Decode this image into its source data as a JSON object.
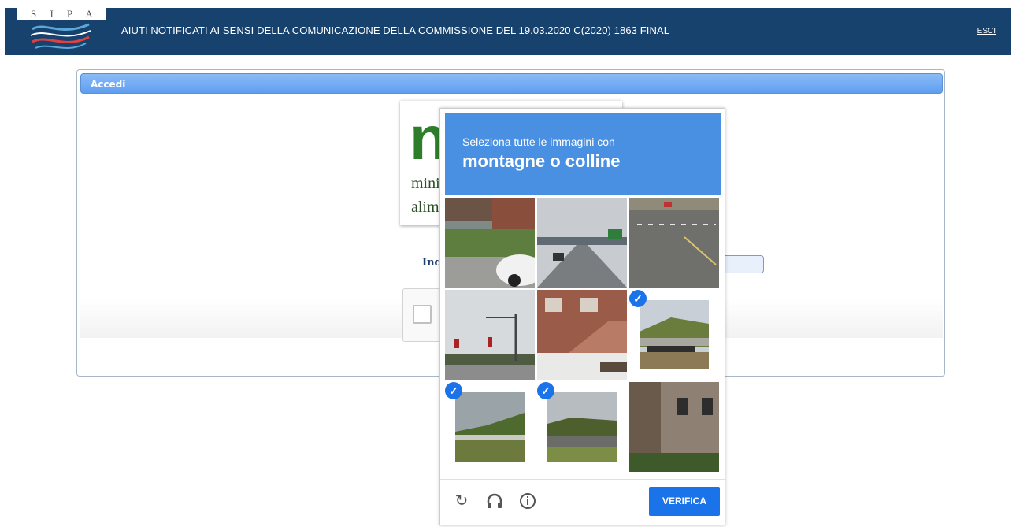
{
  "header": {
    "logo_text": "S I P A",
    "title": "AIUTI NOTIFICATI AI SENSI DELLA COMUNICAZIONE DELLA COMMISSIONE DEL 19.03.2020 C(2020) 1863 FINAL",
    "logout_label": "ESCI"
  },
  "panel": {
    "title": "Accedi",
    "ministry_logo_letter": "n",
    "ministry_line1": "minis",
    "ministry_line2": "alime",
    "field_label": "Ind"
  },
  "captcha": {
    "instruction": "Seleziona tutte le immagini con",
    "target": "montagne o colline",
    "tiles": [
      {
        "scene": "street-house-car",
        "selected": false
      },
      {
        "scene": "highway-overpass",
        "selected": false
      },
      {
        "scene": "road-aerial",
        "selected": false
      },
      {
        "scene": "streetlight-intersection",
        "selected": false
      },
      {
        "scene": "brick-stairs",
        "selected": false
      },
      {
        "scene": "bridge-hill",
        "selected": true
      },
      {
        "scene": "hillside-road",
        "selected": true
      },
      {
        "scene": "hill-field",
        "selected": true
      },
      {
        "scene": "brick-building",
        "selected": false
      }
    ],
    "footer_icons": [
      "reload-icon",
      "audio-icon",
      "info-icon"
    ],
    "verify_label": "VERIFICA"
  },
  "colors": {
    "header_bg": "#17426e",
    "panel_header": "#5e9ef0",
    "captcha_blue": "#4a90e2",
    "verify_blue": "#1a73e8"
  }
}
